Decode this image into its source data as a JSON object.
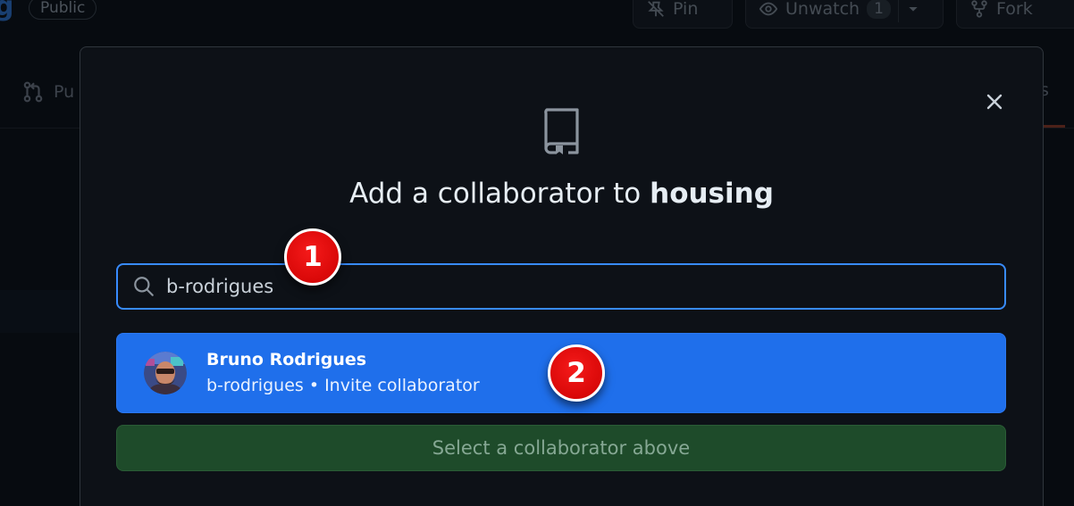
{
  "background": {
    "repo_name_fragment": "g",
    "visibility_badge": "Public",
    "pin_label": "Pin",
    "watch_label": "Unwatch",
    "watch_count": "1",
    "fork_label": "Fork",
    "tab_left_fragment": "Pu",
    "tab_right_fragment": "s"
  },
  "modal": {
    "title_prefix": "Add a collaborator to",
    "repo_name": "housing",
    "search": {
      "value": "b-rodrigues"
    },
    "suggestion": {
      "name": "Bruno Rodrigues",
      "subtitle": "b-rodrigues • Invite collaborator"
    },
    "submit_label": "Select a collaborator above"
  },
  "markers": {
    "first": "1",
    "second": "2"
  },
  "colors": {
    "accent_blue": "#1f6feb",
    "focus_border": "#388bfd",
    "disabled_green": "#1e4b2a",
    "marker_red": "#e00d0d"
  }
}
